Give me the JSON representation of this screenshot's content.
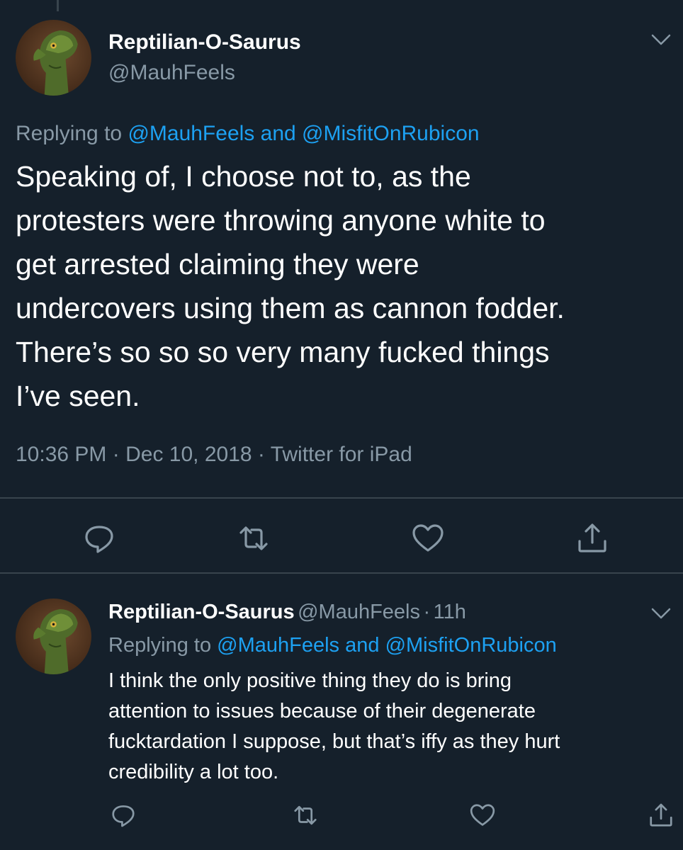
{
  "main_tweet": {
    "author_name": "Reptilian-O-Saurus",
    "author_handle": "@MauhFeels",
    "replying_prefix": "Replying to",
    "replying_user1": "@MauhFeels",
    "replying_and": "and",
    "replying_user2": "@MisfitOnRubicon",
    "text_lines": [
      "Speaking of, I choose not to, as the",
      "protesters were throwing anyone white to",
      "get arrested claiming they were",
      "undercovers using them as cannon fodder.",
      "There’s so so so very many fucked things",
      "I’ve seen."
    ],
    "time": "10:36 PM",
    "date": "Dec 10, 2018",
    "source": "Twitter for iPad",
    "separator": "·"
  },
  "reply_tweet": {
    "author_name": "Reptilian-O-Saurus",
    "author_handle": "@MauhFeels",
    "time_ago": "11h",
    "separator": "·",
    "replying_prefix": "Replying to",
    "replying_user1": "@MauhFeels",
    "replying_and": "and",
    "replying_user2": "@MisfitOnRubicon",
    "text_lines": [
      "I think the only positive thing they do is bring",
      "attention to issues because of their degenerate",
      "fucktardation I suppose, but that’s iffy as they hurt",
      "credibility a lot too."
    ]
  },
  "icons": [
    "reply-icon",
    "retweet-icon",
    "like-icon",
    "share-icon",
    "chevron-down-icon"
  ],
  "colors": {
    "background": "#15202b",
    "text": "#ffffff",
    "muted": "#8899a6",
    "link": "#1da1f2",
    "divider": "#38444d"
  }
}
